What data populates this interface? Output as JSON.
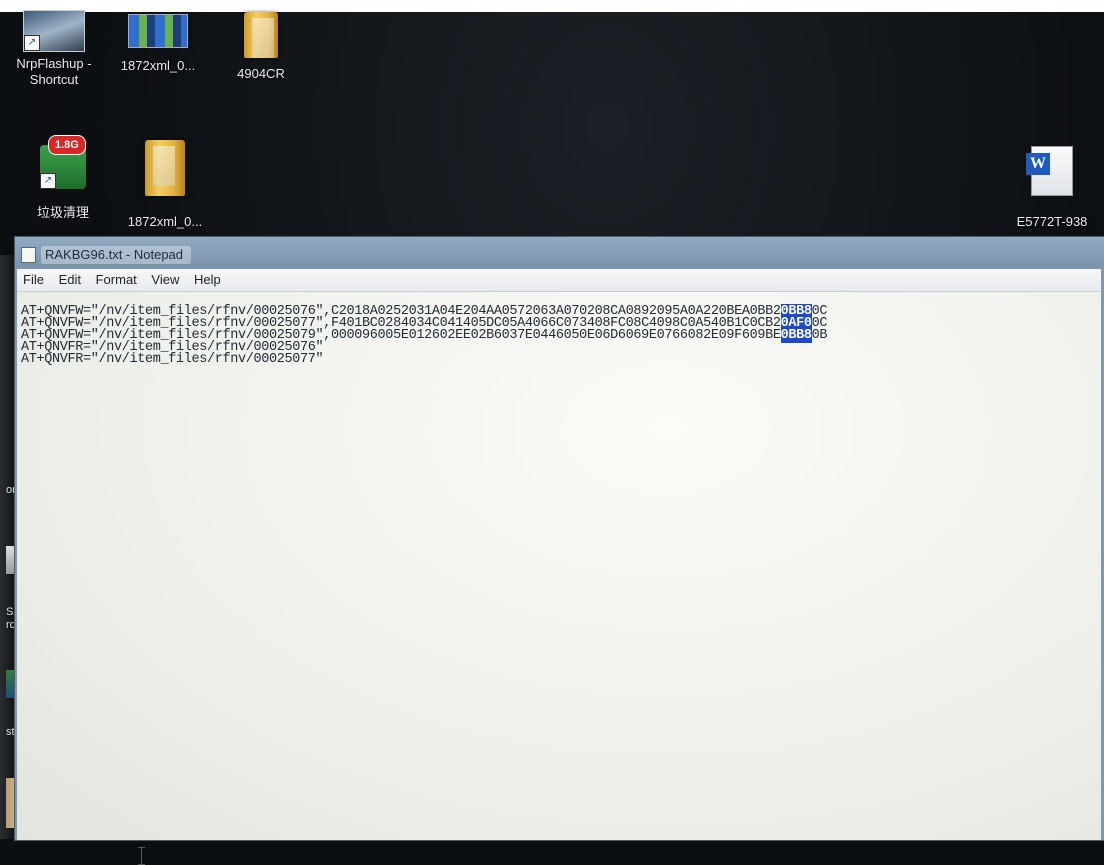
{
  "desktop": {
    "icons": [
      {
        "label_line1": "NrpFlashup -",
        "label_line2": "Shortcut",
        "icon": "app-shortcut-icon"
      },
      {
        "label_line1": "1872xml_0...",
        "icon": "xml-file-icon"
      },
      {
        "label_line1": "4904CR",
        "icon": "folder-icon"
      },
      {
        "label_line1": "垃圾清理",
        "icon": "recycle-cleaner-icon",
        "badge": "1.8G"
      },
      {
        "label_line1": "1872xml_0...",
        "icon": "folder-icon"
      },
      {
        "label_line1": "E5772T-938",
        "icon": "word-document-icon"
      }
    ],
    "left_fragments": [
      "on",
      "SAR",
      "rd_S",
      "st.win."
    ]
  },
  "notepad": {
    "title": "RAKBG96.txt - Notepad",
    "menu": [
      "File",
      "Edit",
      "Format",
      "View",
      "Help"
    ],
    "lines": [
      {
        "pre": "AT+QNVFW=\"/nv/item_files/rfnv/00025076\",C2018A0252031A04E204AA0572063A070208CA0892095A0A220BEA0BB2",
        "sel": "0BB8",
        "post": "0C"
      },
      {
        "pre": "AT+QNVFW=\"/nv/item_files/rfnv/00025077\",F401BC0284034C041405DC05A4066C073408FC08C4098C0A540B1C0CB2",
        "sel": "0AF0",
        "post": "0C"
      },
      {
        "pre": "AT+QNVFW=\"/nv/item_files/rfnv/00025079\",000096005E012602EE02B6037E0446050E06D6069E0766082E09F609BE",
        "sel": "0BB8",
        "post": "0B"
      },
      {
        "pre": "AT+QNVFR=\"/nv/item_files/rfnv/00025076\"",
        "sel": "",
        "post": ""
      },
      {
        "pre": "AT+QNVFR=\"/nv/item_files/rfnv/00025077\"",
        "sel": "",
        "post": ""
      }
    ]
  }
}
